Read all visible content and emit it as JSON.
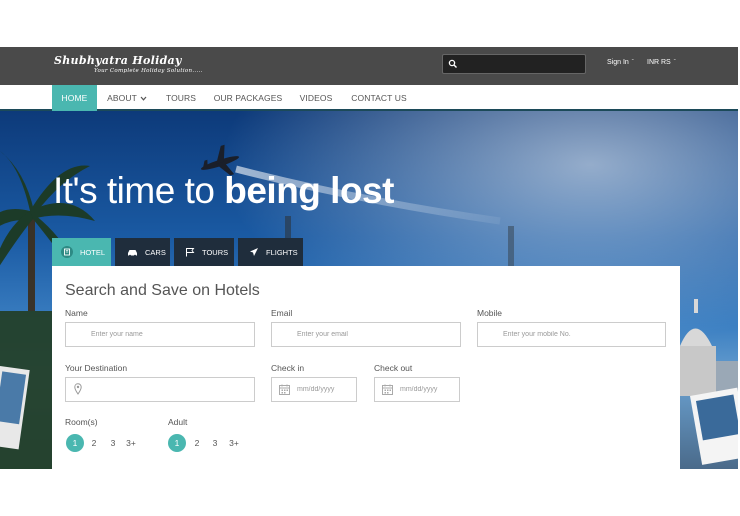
{
  "brand": {
    "name": "Shubhyatra Holiday",
    "tagline": "Your Complete Holiday Solution....."
  },
  "header": {
    "search_placeholder": "",
    "sign_in": "Sign In",
    "currency": "INR RS"
  },
  "nav": {
    "items": [
      {
        "label": "HOME",
        "active": true
      },
      {
        "label": "ABOUT",
        "has_dropdown": true
      },
      {
        "label": "TOURS"
      },
      {
        "label": "OUR PACKAGES"
      },
      {
        "label": "VIDEOS"
      },
      {
        "label": "CONTACT US"
      }
    ]
  },
  "hero": {
    "title_light": "It's time to ",
    "title_bold": "being lost"
  },
  "tabs": [
    {
      "label": "HOTEL",
      "icon": "hotel-icon",
      "active": true
    },
    {
      "label": "CARS",
      "icon": "car-icon"
    },
    {
      "label": "TOURS",
      "icon": "flag-icon"
    },
    {
      "label": "FLIGHTS",
      "icon": "plane-icon"
    }
  ],
  "form": {
    "title": "Search and Save on Hotels",
    "name": {
      "label": "Name",
      "placeholder": "Enter your name"
    },
    "email": {
      "label": "Email",
      "placeholder": "Enter your email"
    },
    "mobile": {
      "label": "Mobile",
      "placeholder": "Enter your mobile No."
    },
    "destination": {
      "label": "Your Destination",
      "placeholder": ""
    },
    "checkin": {
      "label": "Check in",
      "placeholder": "mm/dd/yyyy"
    },
    "checkout": {
      "label": "Check out",
      "placeholder": "mm/dd/yyyy"
    },
    "rooms": {
      "label": "Room(s)",
      "options": [
        "1",
        "2",
        "3",
        "3+"
      ],
      "selected": "1"
    },
    "adult": {
      "label": "Adult",
      "options": [
        "1",
        "2",
        "3",
        "3+"
      ],
      "selected": "1"
    }
  },
  "colors": {
    "accent": "#4ab7b0",
    "topbar": "#4a4a4a",
    "tab_dark": "#1f2d3c"
  }
}
